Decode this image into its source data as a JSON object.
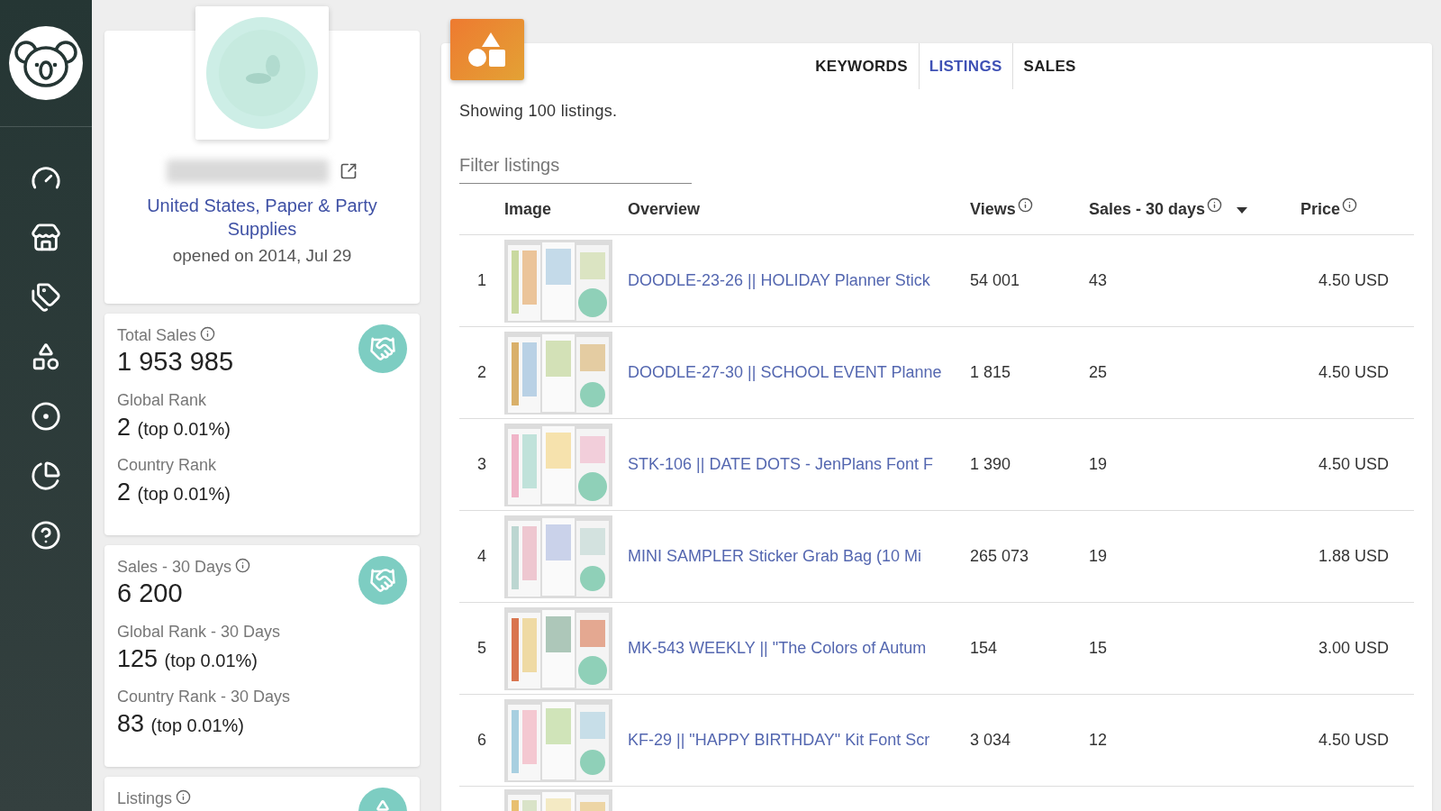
{
  "shop": {
    "location": "United States, Paper & Party Supplies",
    "opened": "opened on 2014, Jul 29"
  },
  "stats": [
    {
      "label": "Total Sales",
      "value": "1 953 985",
      "kind": "handshake",
      "ranks": [
        {
          "label": "Global Rank",
          "value": "2",
          "note": "(top 0.01%)"
        },
        {
          "label": "Country Rank",
          "value": "2",
          "note": "(top 0.01%)"
        }
      ]
    },
    {
      "label": "Sales - 30 Days",
      "value": "6 200",
      "kind": "handshake",
      "ranks": [
        {
          "label": "Global Rank - 30 Days",
          "value": "125",
          "note": "(top 0.01%)"
        },
        {
          "label": "Country Rank - 30 Days",
          "value": "83",
          "note": "(top 0.01%)"
        }
      ]
    },
    {
      "label": "Listings",
      "kind": "shapes"
    }
  ],
  "tabs": [
    {
      "label": "KEYWORDS",
      "selected": false
    },
    {
      "label": "LISTINGS",
      "selected": true
    },
    {
      "label": "SALES",
      "selected": false
    }
  ],
  "summary": "Showing 100 listings.",
  "filter": {
    "placeholder": "Filter listings"
  },
  "table": {
    "columns": [
      {
        "label": "Image",
        "info": false,
        "sorted": false
      },
      {
        "label": "Overview",
        "info": false,
        "sorted": false
      },
      {
        "label": "Views",
        "info": true,
        "sorted": false
      },
      {
        "label": "Sales - 30 days",
        "info": true,
        "sorted": true
      },
      {
        "label": "Price",
        "info": true,
        "sorted": false
      }
    ],
    "rows": [
      {
        "index": "1",
        "title": "DOODLE-23-26 || HOLIDAY Planner Stick",
        "views": "54 001",
        "sales": "43",
        "price": "4.50 USD"
      },
      {
        "index": "2",
        "title": "DOODLE-27-30 || SCHOOL EVENT Planne",
        "views": "1 815",
        "sales": "25",
        "price": "4.50 USD"
      },
      {
        "index": "3",
        "title": "STK-106 || DATE DOTS - JenPlans Font F",
        "views": "1 390",
        "sales": "19",
        "price": "4.50 USD"
      },
      {
        "index": "4",
        "title": "MINI SAMPLER Sticker Grab Bag (10 Mi",
        "views": "265 073",
        "sales": "19",
        "price": "1.88 USD"
      },
      {
        "index": "5",
        "title": "MK-543 WEEKLY || \"The Colors of Autum",
        "views": "154",
        "sales": "15",
        "price": "3.00 USD"
      },
      {
        "index": "6",
        "title": "KF-29 || \"HAPPY BIRTHDAY\" Kit Font Scr",
        "views": "3 034",
        "sales": "12",
        "price": "4.50 USD"
      }
    ]
  }
}
